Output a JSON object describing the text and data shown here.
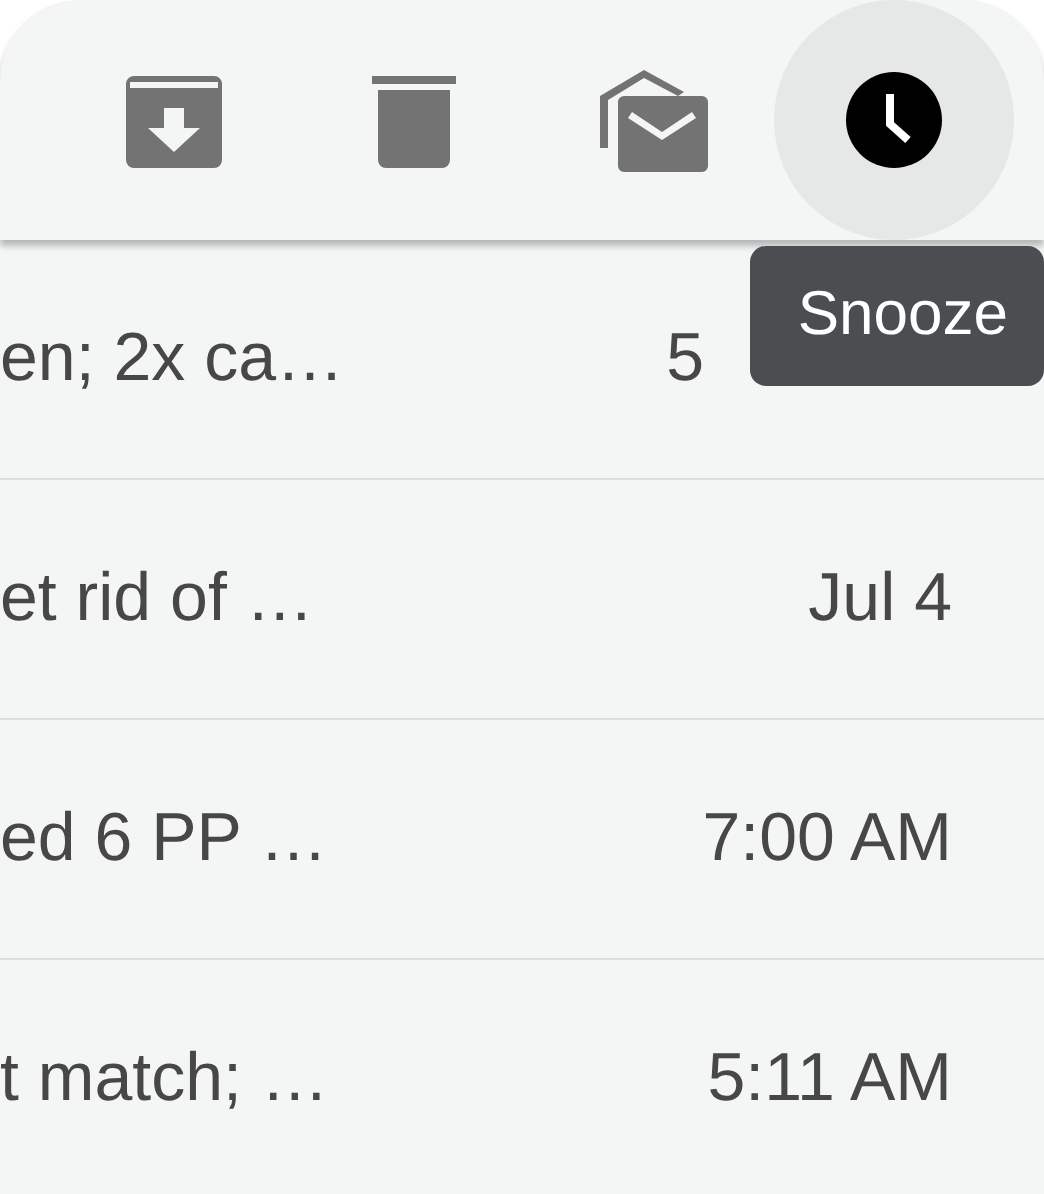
{
  "toolbar": {
    "buttons": [
      {
        "kind": "archive",
        "hovered": false
      },
      {
        "kind": "delete",
        "hovered": false
      },
      {
        "kind": "mark_read",
        "hovered": false
      },
      {
        "kind": "snooze",
        "hovered": true
      }
    ]
  },
  "tooltip": {
    "text": "Snooze"
  },
  "rows": [
    {
      "snippet": "en; 2x ca…",
      "time": "5"
    },
    {
      "snippet": "et rid of …",
      "time": "Jul 4"
    },
    {
      "snippet": "ed 6 PP …",
      "time": "7:00 AM"
    },
    {
      "snippet": "t match; …",
      "time": "5:11 AM"
    }
  ]
}
